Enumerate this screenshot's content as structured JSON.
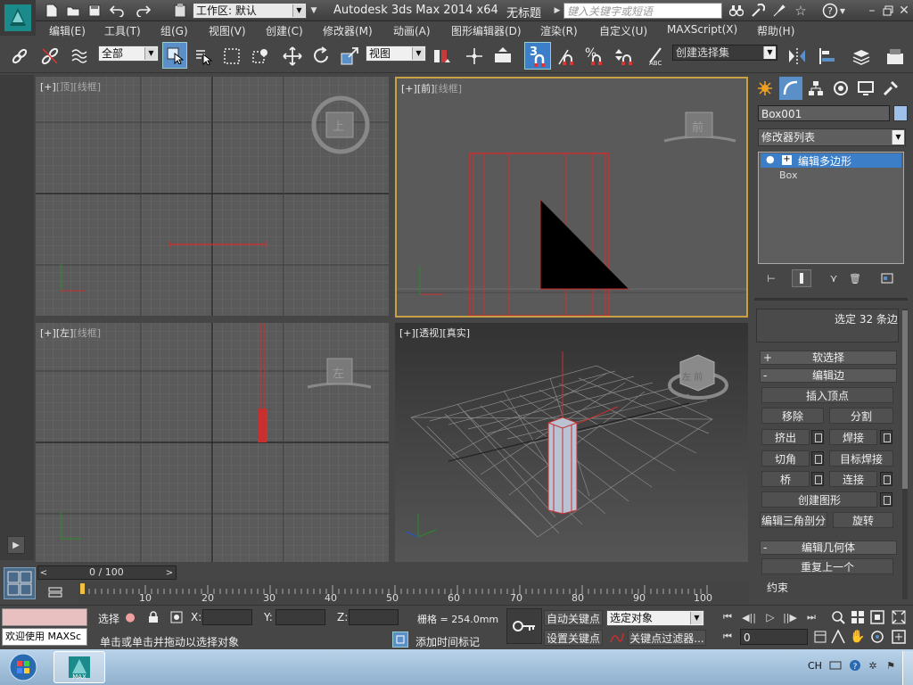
{
  "title_bar": {
    "workspace_label": "工作区: 默认",
    "app_title": "Autodesk 3ds Max  2014 x64",
    "doc_title": "无标题",
    "search_placeholder": "键入关键字或短语"
  },
  "menu": [
    "编辑(E)",
    "工具(T)",
    "组(G)",
    "视图(V)",
    "创建(C)",
    "修改器(M)",
    "动画(A)",
    "图形编辑器(D)",
    "渲染(R)",
    "自定义(U)",
    "MAXScript(X)",
    "帮助(H)"
  ],
  "main_toolbar": {
    "selection_filter": "全部",
    "ref_coord": "视图",
    "snap_label": "3",
    "named_selection": "创建选择集"
  },
  "viewports": {
    "top": {
      "l1": "[+]",
      "l2": "[顶]",
      "l3": "[线框]",
      "cube": "上"
    },
    "front": {
      "l1": "[+]",
      "l2": "[前]",
      "l3": "[线框]",
      "cube": "前"
    },
    "left": {
      "l1": "[+]",
      "l2": "[左]",
      "l3": "[线框]",
      "cube": "左"
    },
    "persp": {
      "l1": "[+]",
      "l2": "[透视]",
      "l3": "[真实]",
      "cube": "左 前"
    }
  },
  "command_panel": {
    "object_name": "Box001",
    "modifier_list": "修改器列表",
    "stack": [
      "编辑多边形",
      "Box"
    ],
    "selection_info": "选定 32 条边",
    "rollouts": {
      "soft": "软选择",
      "edit_edges": "编辑边",
      "edit_geom": "编辑几何体"
    },
    "buttons": {
      "insert_vertex": "插入顶点",
      "remove": "移除",
      "split": "分割",
      "extrude": "挤出",
      "weld": "焊接",
      "chamfer": "切角",
      "target_weld": "目标焊接",
      "bridge": "桥",
      "connect": "连接",
      "create_shape": "创建图形",
      "edit_tri": "编辑三角剖分",
      "turn": "旋转",
      "repeat_last": "重复上一个"
    },
    "constraints_label": "约束"
  },
  "timeline": {
    "frame_label": "0 / 100",
    "ticks": [
      "10",
      "20",
      "30",
      "40",
      "50",
      "60",
      "70",
      "80",
      "90",
      "100"
    ]
  },
  "status": {
    "maxscript_text": "欢迎使用  MAXSc",
    "selected_label": "选择",
    "x_label": "X:",
    "y_label": "Y:",
    "z_label": "Z:",
    "grid_text": "栅格 = 254.0mm",
    "auto_key": "自动关键点",
    "set_key": "设置关键点",
    "key_mode": "选定对象",
    "key_filters": "关键点过滤器...",
    "prompt": "单击或单击并拖动以选择对象",
    "add_time_tag": "添加时间标记",
    "frame_value": "0"
  },
  "taskbar": {
    "lang": "CH",
    "app_icon_label": "MAX"
  },
  "colors": {
    "accent": "#1e6fb9",
    "object_red": "#c81e1e",
    "active_viewport_border": "#c8a046"
  }
}
